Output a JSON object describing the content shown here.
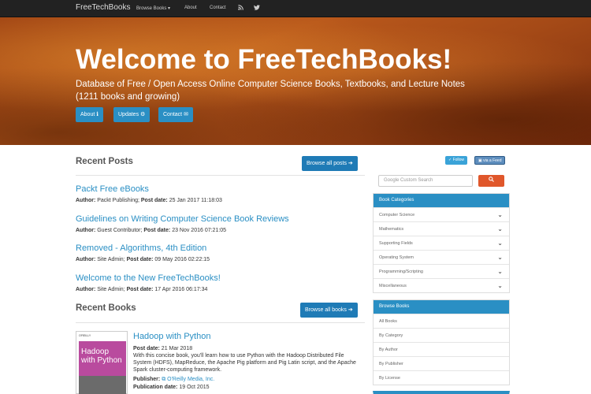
{
  "navbar": {
    "brand": "FreeTechBooks",
    "items": [
      {
        "label": "Browse Books ▾"
      },
      {
        "label": "About"
      },
      {
        "label": "Contact"
      }
    ],
    "icons": [
      "rss-icon",
      "twitter-icon"
    ]
  },
  "hero": {
    "title": "Welcome to FreeTechBooks!",
    "subtitle": "Database of Free / Open Access Online Computer Science Books, Textbooks, and Lecture Notes (1211 books and growing)",
    "buttons": [
      {
        "label": "About ℹ"
      },
      {
        "label": "Updates ⚙"
      },
      {
        "label": "Contact ✉"
      }
    ]
  },
  "recent_posts": {
    "title": "Recent Posts",
    "browse_label": "Browse all posts ➔",
    "author_label": "Author:",
    "date_label": "Post date:",
    "posts": [
      {
        "title": "Packt Free eBooks",
        "author": "Packt Publishing;",
        "date": "25 Jan 2017 11:18:03"
      },
      {
        "title": "Guidelines on Writing Computer Science Book Reviews",
        "author": "Guest Contributor;",
        "date": "23 Nov 2016 07:21:05"
      },
      {
        "title": "Removed - Algorithms, 4th Edition",
        "author": "Site Admin;",
        "date": "09 May 2016 02:22:15"
      },
      {
        "title": "Welcome to the New FreeTechBooks!",
        "author": "Site Admin;",
        "date": "17 Apr 2016 06:17:34"
      }
    ]
  },
  "recent_books": {
    "title": "Recent Books",
    "browse_label": "Browse all books ➔",
    "book": {
      "title": "Hadoop with Python",
      "cover_publisher": "O'REILLY",
      "cover_title": "Hadoop with Python",
      "post_date_label": "Post date:",
      "post_date": "21 Mar 2018",
      "description": "With this concise book, you'll learn how to use Python with the Hadoop Distributed File System (HDFS), MapReduce, the Apache Pig platform and Pig Latin script, and the Apache Spark cluster-computing framework.",
      "publisher_label": "Publisher:",
      "publisher": "O'Reilly Media, Inc.",
      "pub_date_label": "Publication date:",
      "pub_date": "19 Oct 2015"
    }
  },
  "sidebar": {
    "follow_label": "Follow",
    "feed_label": "via a Feed",
    "search_placeholder": "Google Custom Search",
    "search_icon": "magnifier-icon",
    "categories": {
      "title": "Book Categories",
      "items": [
        {
          "label": "Computer Science"
        },
        {
          "label": "Mathematics"
        },
        {
          "label": "Supporting Fields"
        },
        {
          "label": "Operating System"
        },
        {
          "label": "Programming/Scripting"
        },
        {
          "label": "Miscellaneous"
        }
      ]
    },
    "browse": {
      "title": "Browse Books",
      "items": [
        {
          "label": "All Books"
        },
        {
          "label": "By Category"
        },
        {
          "label": "By Author"
        },
        {
          "label": "By Publisher"
        },
        {
          "label": "By License"
        }
      ]
    }
  },
  "colors": {
    "navbar": "#222222",
    "accent": "#2a8fc4",
    "search_button": "#e0572b"
  }
}
